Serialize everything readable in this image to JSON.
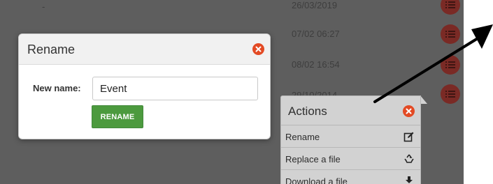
{
  "background": {
    "rows": [
      {
        "name": "-",
        "date": "26/03/2019"
      },
      {
        "name": "",
        "date": "07/02 06:27"
      },
      {
        "name": "",
        "date": "08/02 16:54"
      },
      {
        "name": "",
        "date": "29/10/2014"
      }
    ]
  },
  "rename_dialog": {
    "title": "Rename",
    "label": "New name:",
    "input_value": "Event",
    "button_label": "RENAME"
  },
  "actions_popover": {
    "title": "Actions",
    "items": [
      {
        "label": "Rename",
        "icon": "edit-icon"
      },
      {
        "label": "Replace a file",
        "icon": "recycle-icon"
      },
      {
        "label": "Download a file",
        "icon": "download-icon"
      }
    ]
  },
  "colors": {
    "overlay": "#5e5e5e",
    "close": "#e34a24",
    "rename_button": "#4c9a3e",
    "list_button": "#7a2a25"
  }
}
